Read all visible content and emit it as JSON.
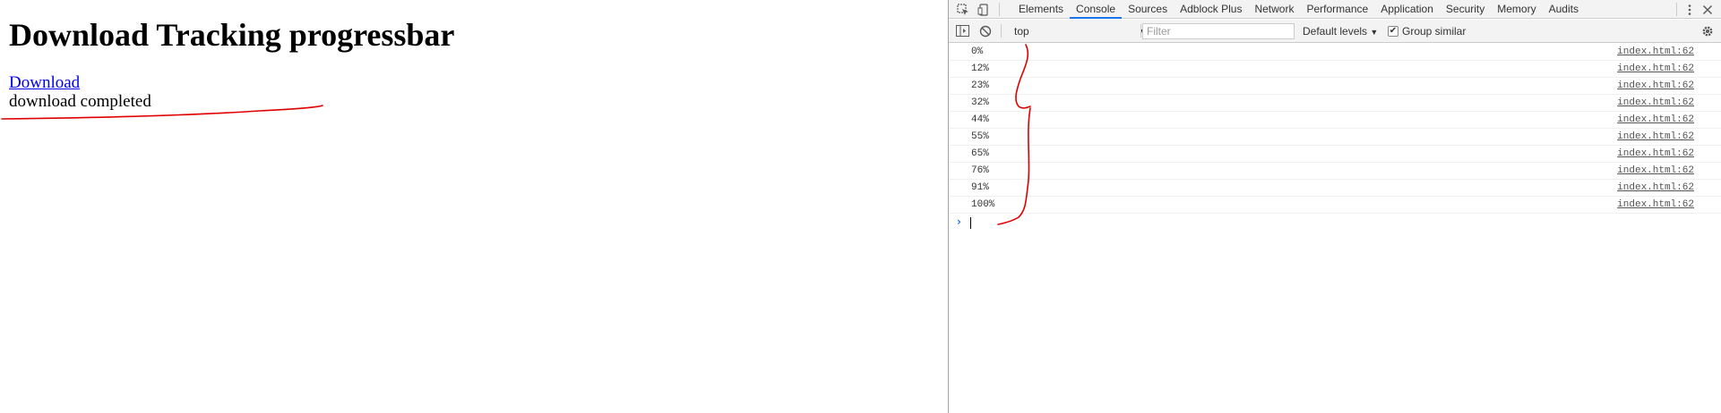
{
  "page": {
    "title": "Download Tracking progressbar",
    "link_label": "Download",
    "status_text": "download completed"
  },
  "devtools": {
    "tabs": [
      {
        "label": "Elements",
        "active": false
      },
      {
        "label": "Console",
        "active": true
      },
      {
        "label": "Sources",
        "active": false
      },
      {
        "label": "Adblock Plus",
        "active": false
      },
      {
        "label": "Network",
        "active": false
      },
      {
        "label": "Performance",
        "active": false
      },
      {
        "label": "Application",
        "active": false
      },
      {
        "label": "Security",
        "active": false
      },
      {
        "label": "Memory",
        "active": false
      },
      {
        "label": "Audits",
        "active": false
      }
    ],
    "toolbar": {
      "context": "top",
      "filter_placeholder": "Filter",
      "levels": "Default levels",
      "group_similar_label": "Group similar",
      "group_similar_checked": true
    },
    "console_logs": [
      {
        "message": "0%",
        "source": "index.html:62"
      },
      {
        "message": "12%",
        "source": "index.html:62"
      },
      {
        "message": "23%",
        "source": "index.html:62"
      },
      {
        "message": "32%",
        "source": "index.html:62"
      },
      {
        "message": "44%",
        "source": "index.html:62"
      },
      {
        "message": "55%",
        "source": "index.html:62"
      },
      {
        "message": "65%",
        "source": "index.html:62"
      },
      {
        "message": "76%",
        "source": "index.html:62"
      },
      {
        "message": "91%",
        "source": "index.html:62"
      },
      {
        "message": "100%",
        "source": "index.html:62"
      }
    ],
    "prompt_symbol": "›"
  },
  "colors": {
    "accent": "#1a73e8",
    "link": "#0000ee",
    "annotation": "#e00000"
  },
  "icons": [
    "inspect-element-icon",
    "device-toolbar-icon",
    "kebab-menu-icon",
    "close-icon",
    "sidebar-toggle-icon",
    "clear-console-icon",
    "settings-gear-icon"
  ]
}
